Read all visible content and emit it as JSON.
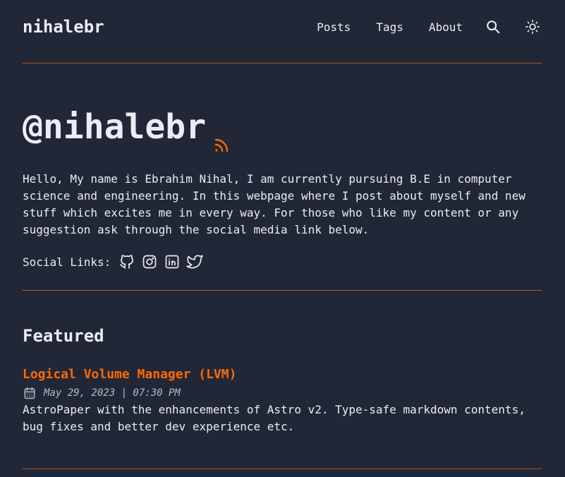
{
  "header": {
    "site_name": "nihalebr",
    "nav": {
      "posts": "Posts",
      "tags": "Tags",
      "about": "About"
    },
    "search_icon": "search-icon",
    "theme_icon": "sun-icon"
  },
  "hero": {
    "title": "@nihalebr",
    "rss_icon": "rss-icon",
    "intro": "Hello, My name is Ebrahim Nihal, I am currently pursuing B.E in computer science and engineering. In this webpage where I post about myself and new stuff which excites me in every way. For those who like my content or any suggestion ask through the social media link below.",
    "social_label": "Social Links:",
    "social_icons": [
      "github-icon",
      "instagram-icon",
      "linkedin-icon",
      "twitter-icon"
    ]
  },
  "featured": {
    "heading": "Featured",
    "posts": [
      {
        "title": "Logical Volume Manager (LVM)",
        "date": "May 29, 2023 | 07:30 PM",
        "description": "AstroPaper with the enhancements of Astro v2. Type-safe markdown contents, bug fixes and better dev experience etc."
      }
    ]
  },
  "colors": {
    "background": "#212737",
    "text": "#eaedf3",
    "accent": "#ff6b01"
  }
}
